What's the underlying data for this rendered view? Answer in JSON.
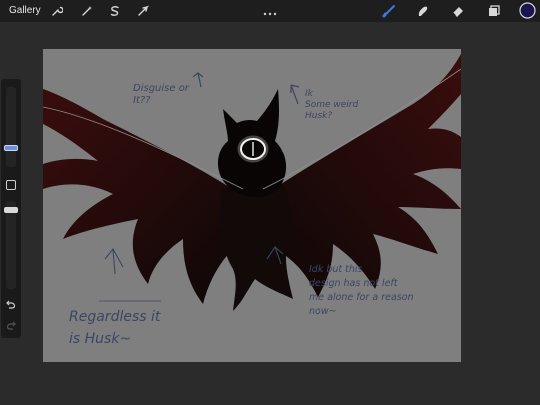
{
  "topbar": {
    "gallery_label": "Gallery",
    "left_tools": [
      "wrench-icon",
      "magic-wand-icon",
      "selection-s-icon",
      "transform-arrow-icon"
    ],
    "right_tools": [
      "brush-icon",
      "smudge-icon",
      "eraser-icon",
      "layers-icon",
      "color-swatch"
    ],
    "active_color": "#1a1550",
    "active_tool_color": "#3a7bd5"
  },
  "sidebar": {
    "brush_size_level": 0.28,
    "opacity_level": 0.5,
    "controls": [
      "brush-size-slider",
      "modify-square-button",
      "opacity-slider",
      "undo-icon",
      "redo-icon"
    ]
  },
  "canvas": {
    "background": "#7f7f7f",
    "notes": {
      "top_left": "Disguise or\nIt??",
      "top_right": "Ik\nSome weird\nHusk?",
      "bottom_left_1": "Regardless it",
      "bottom_left_2": "is Husk~",
      "bottom_right": "Idk but this\ndesign has not left\nme alone for a reason\nnow~"
    }
  }
}
